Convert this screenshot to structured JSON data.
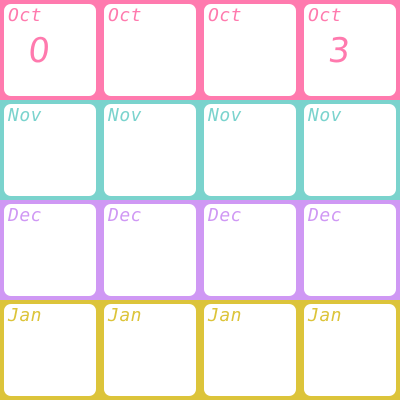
{
  "rows": [
    {
      "label": "Oct",
      "color": "#ff7aae",
      "marks": [
        "0",
        "",
        "",
        "3"
      ]
    },
    {
      "label": "Nov",
      "color": "#7ad3cd",
      "marks": [
        "",
        "",
        "",
        ""
      ]
    },
    {
      "label": "Dec",
      "color": "#cf98f4",
      "marks": [
        "",
        "",
        "",
        ""
      ]
    },
    {
      "label": "Jan",
      "color": "#dcc43a",
      "marks": [
        "",
        "",
        "",
        ""
      ]
    }
  ]
}
